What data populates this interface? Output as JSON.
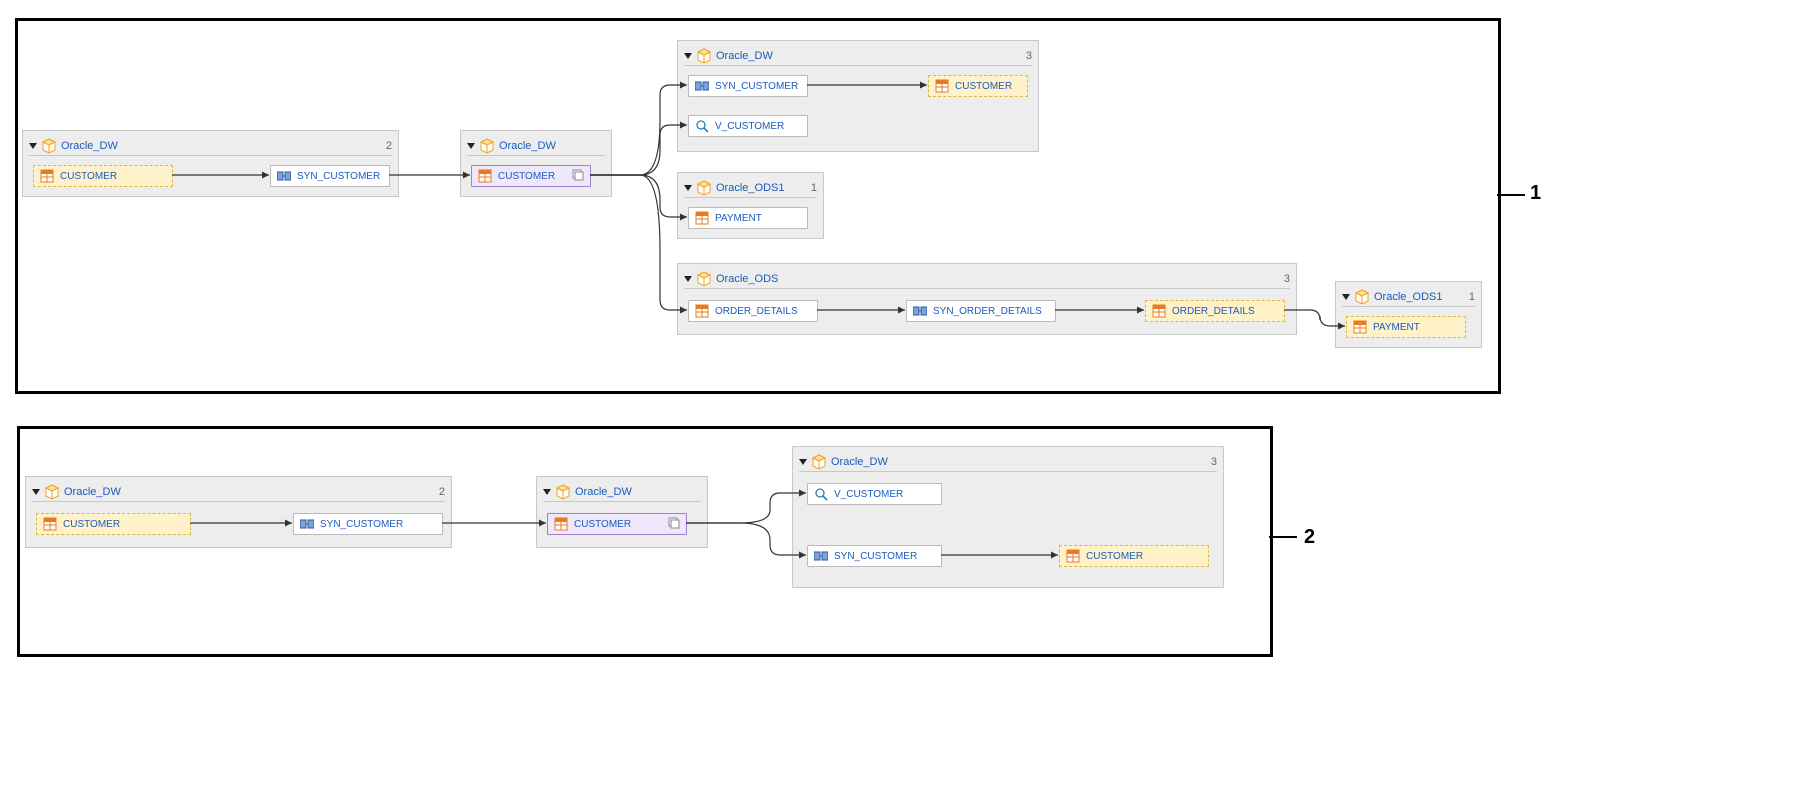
{
  "regions": {
    "r1": {
      "label": "1"
    },
    "r2": {
      "label": "2"
    }
  },
  "schemas": {
    "oracle_dw": "Oracle_DW",
    "oracle_ods": "Oracle_ODS",
    "oracle_ods1": "Oracle_ODS1"
  },
  "counts": {
    "g1a": "2",
    "g1c": "3",
    "g1d": "1",
    "g1e": "3",
    "g1f": "1",
    "g2a": "2",
    "g2c": "3"
  },
  "items": {
    "customer": "CUSTOMER",
    "syn_customer": "SYN_CUSTOMER",
    "v_customer": "V_CUSTOMER",
    "payment": "PAYMENT",
    "order_details": "ORDER_DETAILS",
    "syn_order_details": "SYN_ORDER_DETAILS"
  }
}
